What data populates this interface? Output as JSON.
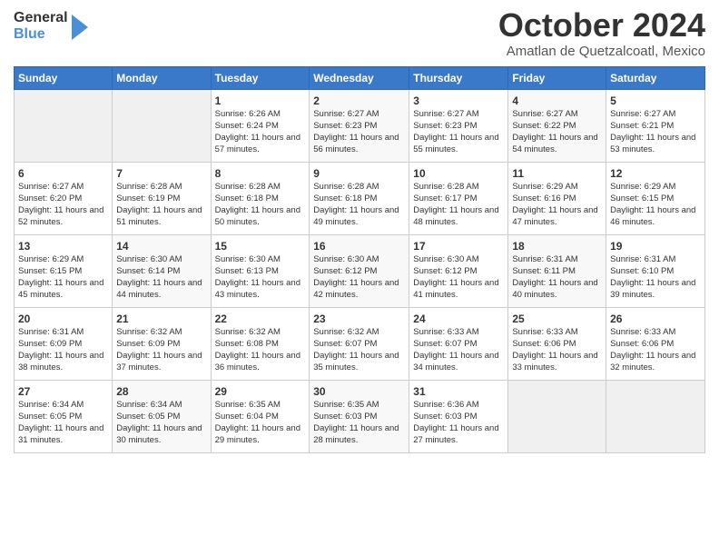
{
  "logo": {
    "line1": "General",
    "line2": "Blue"
  },
  "title": "October 2024",
  "location": "Amatlan de Quetzalcoatl, Mexico",
  "weekdays": [
    "Sunday",
    "Monday",
    "Tuesday",
    "Wednesday",
    "Thursday",
    "Friday",
    "Saturday"
  ],
  "weeks": [
    [
      {
        "day": "",
        "sunrise": "",
        "sunset": "",
        "daylight": ""
      },
      {
        "day": "",
        "sunrise": "",
        "sunset": "",
        "daylight": ""
      },
      {
        "day": "1",
        "sunrise": "Sunrise: 6:26 AM",
        "sunset": "Sunset: 6:24 PM",
        "daylight": "Daylight: 11 hours and 57 minutes."
      },
      {
        "day": "2",
        "sunrise": "Sunrise: 6:27 AM",
        "sunset": "Sunset: 6:23 PM",
        "daylight": "Daylight: 11 hours and 56 minutes."
      },
      {
        "day": "3",
        "sunrise": "Sunrise: 6:27 AM",
        "sunset": "Sunset: 6:23 PM",
        "daylight": "Daylight: 11 hours and 55 minutes."
      },
      {
        "day": "4",
        "sunrise": "Sunrise: 6:27 AM",
        "sunset": "Sunset: 6:22 PM",
        "daylight": "Daylight: 11 hours and 54 minutes."
      },
      {
        "day": "5",
        "sunrise": "Sunrise: 6:27 AM",
        "sunset": "Sunset: 6:21 PM",
        "daylight": "Daylight: 11 hours and 53 minutes."
      }
    ],
    [
      {
        "day": "6",
        "sunrise": "Sunrise: 6:27 AM",
        "sunset": "Sunset: 6:20 PM",
        "daylight": "Daylight: 11 hours and 52 minutes."
      },
      {
        "day": "7",
        "sunrise": "Sunrise: 6:28 AM",
        "sunset": "Sunset: 6:19 PM",
        "daylight": "Daylight: 11 hours and 51 minutes."
      },
      {
        "day": "8",
        "sunrise": "Sunrise: 6:28 AM",
        "sunset": "Sunset: 6:18 PM",
        "daylight": "Daylight: 11 hours and 50 minutes."
      },
      {
        "day": "9",
        "sunrise": "Sunrise: 6:28 AM",
        "sunset": "Sunset: 6:18 PM",
        "daylight": "Daylight: 11 hours and 49 minutes."
      },
      {
        "day": "10",
        "sunrise": "Sunrise: 6:28 AM",
        "sunset": "Sunset: 6:17 PM",
        "daylight": "Daylight: 11 hours and 48 minutes."
      },
      {
        "day": "11",
        "sunrise": "Sunrise: 6:29 AM",
        "sunset": "Sunset: 6:16 PM",
        "daylight": "Daylight: 11 hours and 47 minutes."
      },
      {
        "day": "12",
        "sunrise": "Sunrise: 6:29 AM",
        "sunset": "Sunset: 6:15 PM",
        "daylight": "Daylight: 11 hours and 46 minutes."
      }
    ],
    [
      {
        "day": "13",
        "sunrise": "Sunrise: 6:29 AM",
        "sunset": "Sunset: 6:15 PM",
        "daylight": "Daylight: 11 hours and 45 minutes."
      },
      {
        "day": "14",
        "sunrise": "Sunrise: 6:30 AM",
        "sunset": "Sunset: 6:14 PM",
        "daylight": "Daylight: 11 hours and 44 minutes."
      },
      {
        "day": "15",
        "sunrise": "Sunrise: 6:30 AM",
        "sunset": "Sunset: 6:13 PM",
        "daylight": "Daylight: 11 hours and 43 minutes."
      },
      {
        "day": "16",
        "sunrise": "Sunrise: 6:30 AM",
        "sunset": "Sunset: 6:12 PM",
        "daylight": "Daylight: 11 hours and 42 minutes."
      },
      {
        "day": "17",
        "sunrise": "Sunrise: 6:30 AM",
        "sunset": "Sunset: 6:12 PM",
        "daylight": "Daylight: 11 hours and 41 minutes."
      },
      {
        "day": "18",
        "sunrise": "Sunrise: 6:31 AM",
        "sunset": "Sunset: 6:11 PM",
        "daylight": "Daylight: 11 hours and 40 minutes."
      },
      {
        "day": "19",
        "sunrise": "Sunrise: 6:31 AM",
        "sunset": "Sunset: 6:10 PM",
        "daylight": "Daylight: 11 hours and 39 minutes."
      }
    ],
    [
      {
        "day": "20",
        "sunrise": "Sunrise: 6:31 AM",
        "sunset": "Sunset: 6:09 PM",
        "daylight": "Daylight: 11 hours and 38 minutes."
      },
      {
        "day": "21",
        "sunrise": "Sunrise: 6:32 AM",
        "sunset": "Sunset: 6:09 PM",
        "daylight": "Daylight: 11 hours and 37 minutes."
      },
      {
        "day": "22",
        "sunrise": "Sunrise: 6:32 AM",
        "sunset": "Sunset: 6:08 PM",
        "daylight": "Daylight: 11 hours and 36 minutes."
      },
      {
        "day": "23",
        "sunrise": "Sunrise: 6:32 AM",
        "sunset": "Sunset: 6:07 PM",
        "daylight": "Daylight: 11 hours and 35 minutes."
      },
      {
        "day": "24",
        "sunrise": "Sunrise: 6:33 AM",
        "sunset": "Sunset: 6:07 PM",
        "daylight": "Daylight: 11 hours and 34 minutes."
      },
      {
        "day": "25",
        "sunrise": "Sunrise: 6:33 AM",
        "sunset": "Sunset: 6:06 PM",
        "daylight": "Daylight: 11 hours and 33 minutes."
      },
      {
        "day": "26",
        "sunrise": "Sunrise: 6:33 AM",
        "sunset": "Sunset: 6:06 PM",
        "daylight": "Daylight: 11 hours and 32 minutes."
      }
    ],
    [
      {
        "day": "27",
        "sunrise": "Sunrise: 6:34 AM",
        "sunset": "Sunset: 6:05 PM",
        "daylight": "Daylight: 11 hours and 31 minutes."
      },
      {
        "day": "28",
        "sunrise": "Sunrise: 6:34 AM",
        "sunset": "Sunset: 6:05 PM",
        "daylight": "Daylight: 11 hours and 30 minutes."
      },
      {
        "day": "29",
        "sunrise": "Sunrise: 6:35 AM",
        "sunset": "Sunset: 6:04 PM",
        "daylight": "Daylight: 11 hours and 29 minutes."
      },
      {
        "day": "30",
        "sunrise": "Sunrise: 6:35 AM",
        "sunset": "Sunset: 6:03 PM",
        "daylight": "Daylight: 11 hours and 28 minutes."
      },
      {
        "day": "31",
        "sunrise": "Sunrise: 6:36 AM",
        "sunset": "Sunset: 6:03 PM",
        "daylight": "Daylight: 11 hours and 27 minutes."
      },
      {
        "day": "",
        "sunrise": "",
        "sunset": "",
        "daylight": ""
      },
      {
        "day": "",
        "sunrise": "",
        "sunset": "",
        "daylight": ""
      }
    ]
  ]
}
